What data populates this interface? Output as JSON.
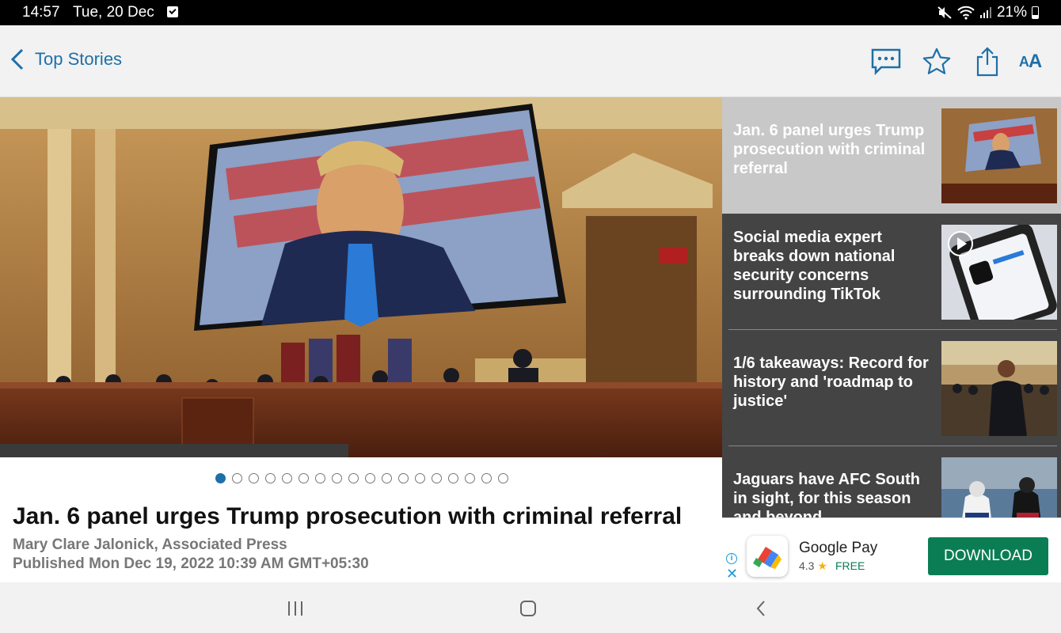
{
  "status_bar": {
    "time": "14:57",
    "date": "Tue, 20 Dec",
    "battery": "21%"
  },
  "toolbar": {
    "back_label": "Top Stories",
    "font_size_label_small": "A",
    "font_size_label_large": "A"
  },
  "carousel": {
    "total_pages": 18,
    "current_page": 1
  },
  "article": {
    "headline": "Jan. 6 panel urges Trump prosecution with criminal referral",
    "byline": "Mary Clare Jalonick, Associated Press",
    "published": "Published Mon Dec 19, 2022 10:39 AM GMT+05:30"
  },
  "side_stories": [
    {
      "title": "Jan. 6 panel urges Trump prosecution with criminal referral",
      "selected": true,
      "video": false
    },
    {
      "title": "Social media expert breaks down national security concerns surrounding TikTok",
      "selected": false,
      "video": true
    },
    {
      "title": "1/6 takeaways: Record for history and 'roadmap to justice'",
      "selected": false,
      "video": false
    },
    {
      "title": "Jaguars have AFC South in sight, for this season and beyond",
      "selected": false,
      "video": false
    }
  ],
  "ad": {
    "app_name": "Google Pay",
    "rating": "4.3",
    "price": "FREE",
    "button_label": "DOWNLOAD",
    "info_glyph": "i",
    "close_glyph": "✕"
  },
  "colors": {
    "accent": "#1d70a8",
    "side_bg": "#444444",
    "selected_bg": "#c8c8c8",
    "ad_button": "#0b7d55"
  }
}
